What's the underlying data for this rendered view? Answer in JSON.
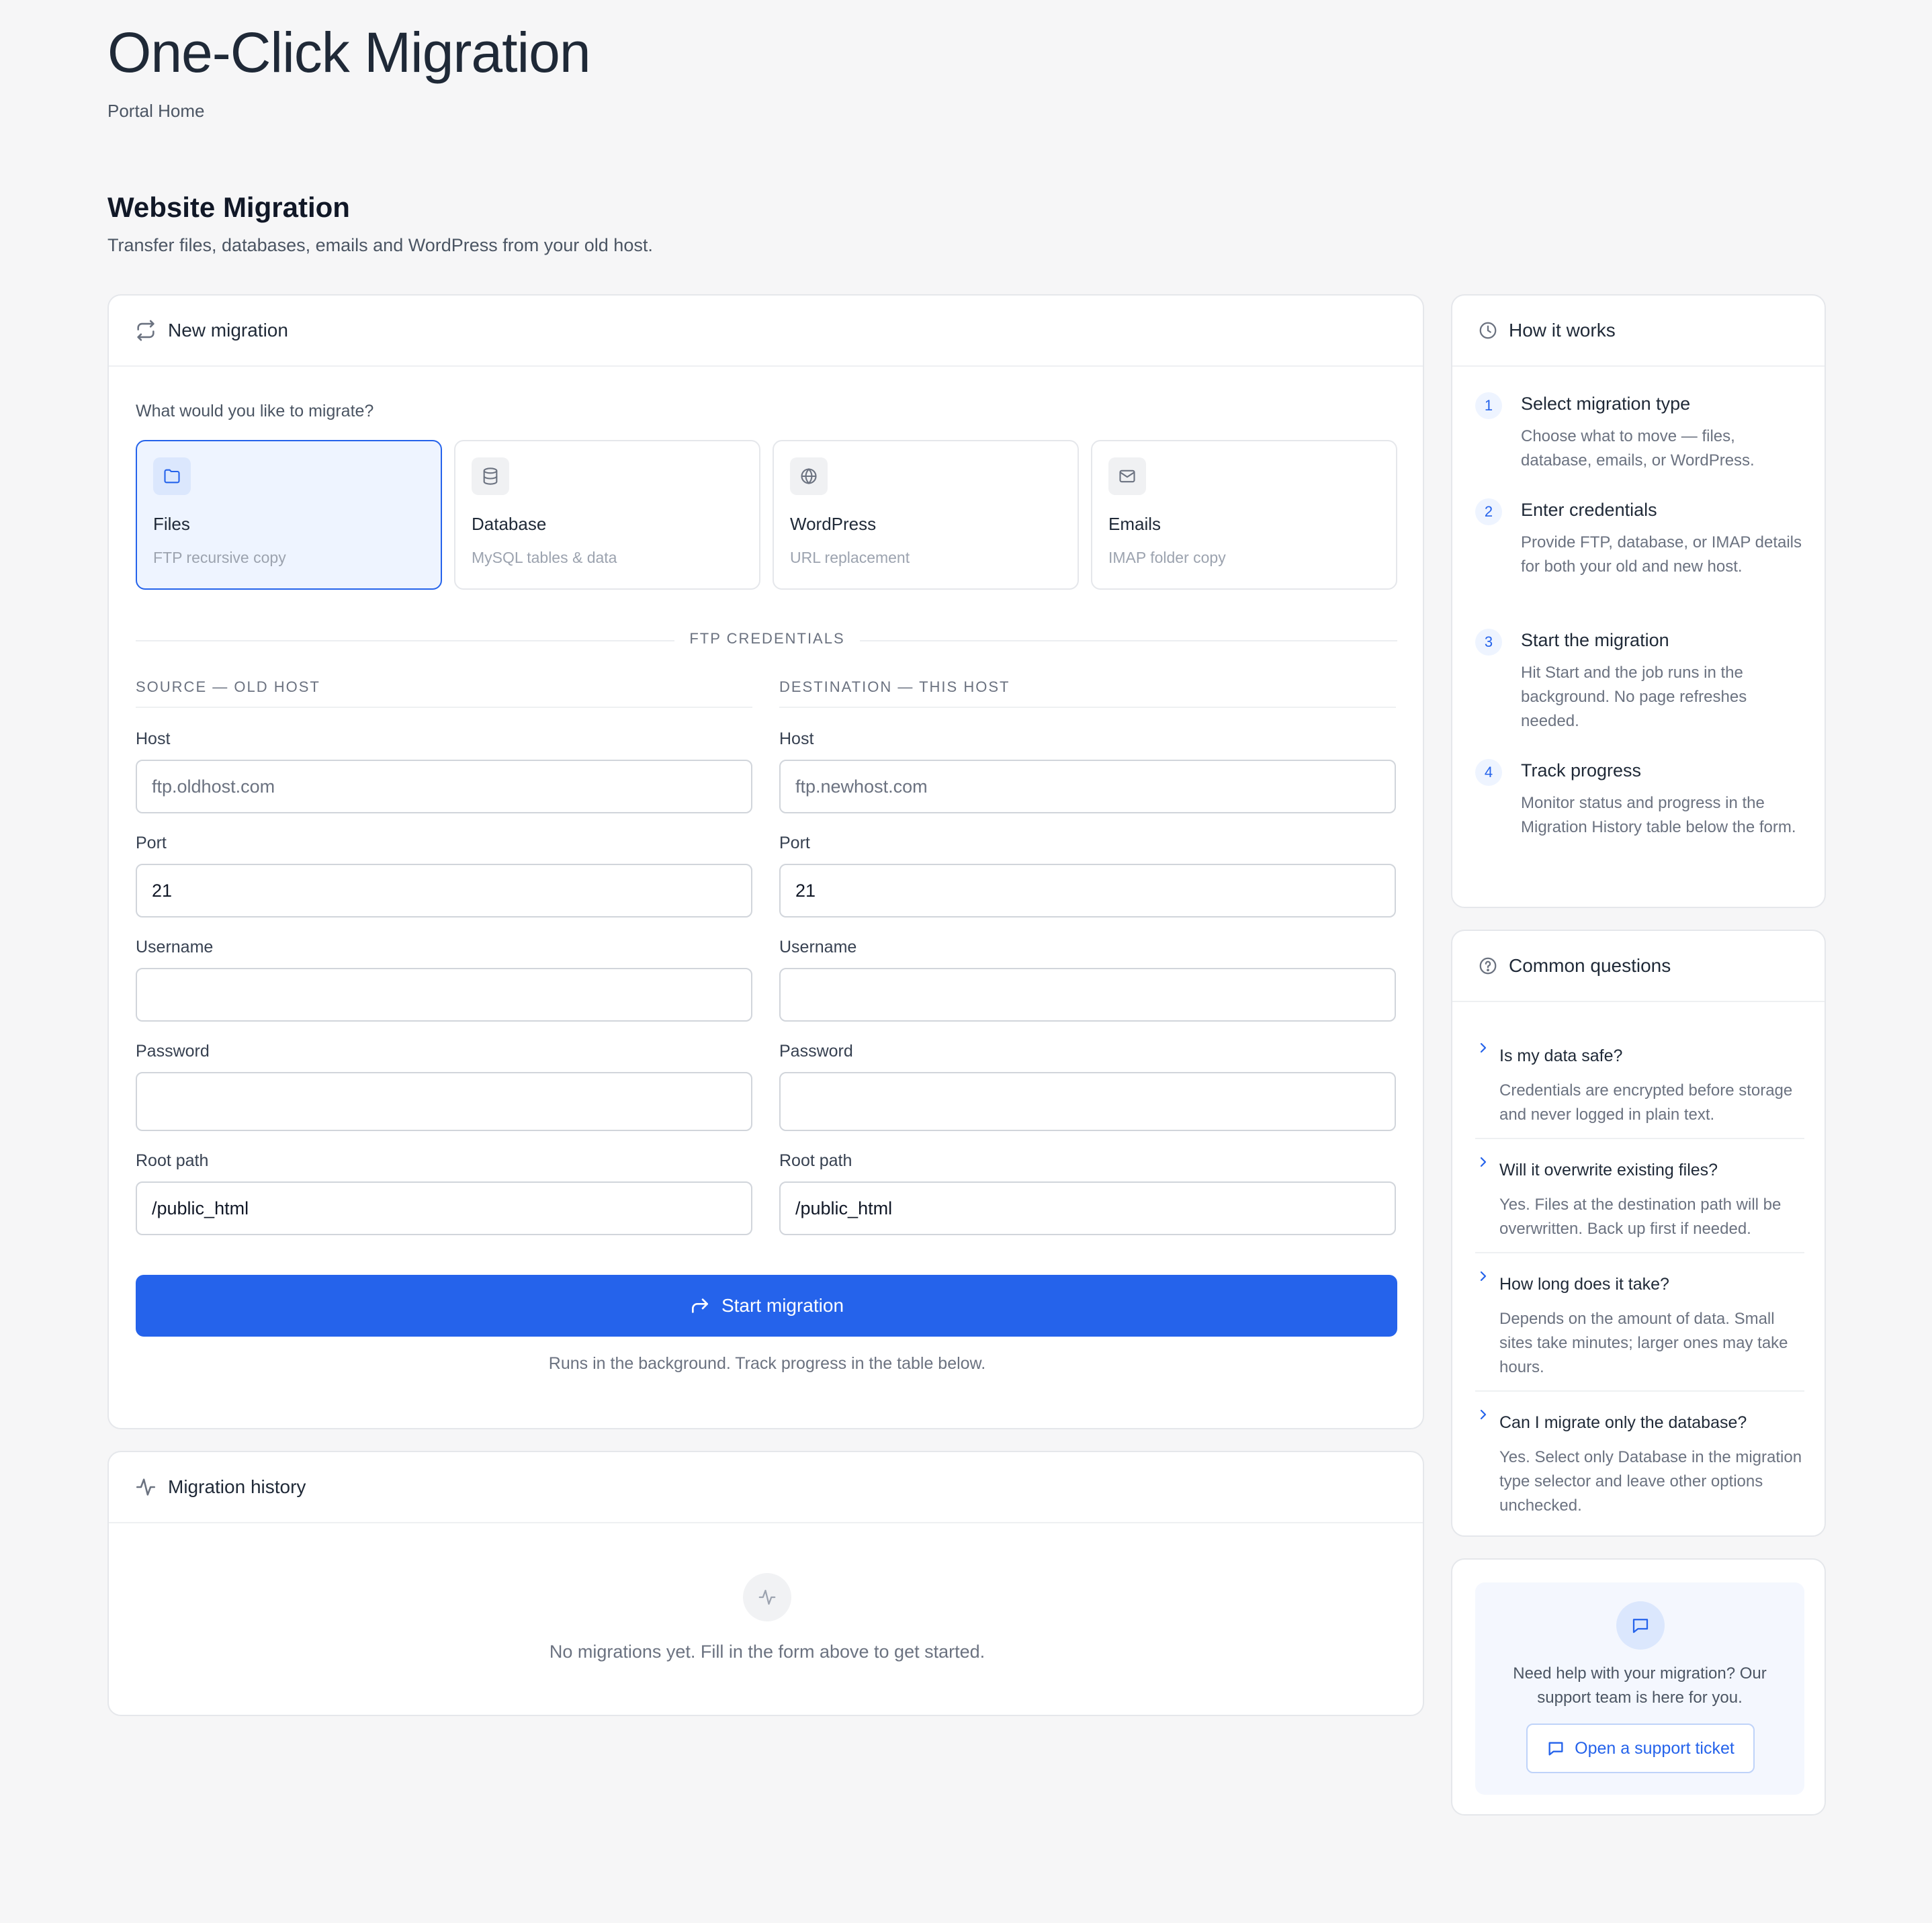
{
  "page": {
    "title": "One-Click Migration",
    "breadcrumb": "Portal Home"
  },
  "section": {
    "title": "Website Migration",
    "subtitle": "Transfer files, databases, emails and WordPress from your old host."
  },
  "new_migration": {
    "header": "New migration",
    "question": "What would you like to migrate?",
    "types": [
      {
        "name": "Files",
        "desc": "FTP recursive copy",
        "icon": "folder-icon",
        "selected": true
      },
      {
        "name": "Database",
        "desc": "MySQL tables & data",
        "icon": "database-icon",
        "selected": false
      },
      {
        "name": "WordPress",
        "desc": "URL replacement",
        "icon": "globe-icon",
        "selected": false
      },
      {
        "name": "Emails",
        "desc": "IMAP folder copy",
        "icon": "mail-icon",
        "selected": false
      }
    ],
    "credentials_label": "FTP CREDENTIALS",
    "source": {
      "heading": "SOURCE — OLD HOST",
      "host_label": "Host",
      "host_placeholder": "ftp.oldhost.com",
      "host_value": "",
      "port_label": "Port",
      "port_value": "21",
      "username_label": "Username",
      "username_value": "",
      "password_label": "Password",
      "password_value": "",
      "root_label": "Root path",
      "root_value": "/public_html"
    },
    "destination": {
      "heading": "DESTINATION — THIS HOST",
      "host_label": "Host",
      "host_placeholder": "ftp.newhost.com",
      "host_value": "",
      "port_label": "Port",
      "port_value": "21",
      "username_label": "Username",
      "username_value": "",
      "password_label": "Password",
      "password_value": "",
      "root_label": "Root path",
      "root_value": "/public_html"
    },
    "start_label": "Start migration",
    "note": "Runs in the background. Track progress in the table below."
  },
  "history": {
    "header": "Migration history",
    "empty": "No migrations yet. Fill in the form above to get started."
  },
  "how_it_works": {
    "header": "How it works",
    "steps": [
      {
        "num": "1",
        "title": "Select migration type",
        "desc": "Choose what to move — files, database, emails, or WordPress."
      },
      {
        "num": "2",
        "title": "Enter credentials",
        "desc": "Provide FTP, database, or IMAP details for both your old and new host."
      },
      {
        "num": "3",
        "title": "Start the migration",
        "desc": "Hit Start and the job runs in the background. No page refreshes needed."
      },
      {
        "num": "4",
        "title": "Track progress",
        "desc": "Monitor status and progress in the Migration History table below the form."
      }
    ]
  },
  "faq": {
    "header": "Common questions",
    "items": [
      {
        "q": "Is my data safe?",
        "a": "Credentials are encrypted before storage and never logged in plain text."
      },
      {
        "q": "Will it overwrite existing files?",
        "a": "Yes. Files at the destination path will be overwritten. Back up first if needed."
      },
      {
        "q": "How long does it take?",
        "a": "Depends on the amount of data. Small sites take minutes; larger ones may take hours."
      },
      {
        "q": "Can I migrate only the database?",
        "a": "Yes. Select only Database in the migration type selector and leave other options unchecked."
      }
    ]
  },
  "help": {
    "text": "Need help with your migration? Our support team is here for you.",
    "button": "Open a support ticket"
  },
  "colors": {
    "accent": "#2563eb",
    "background": "#f6f6f7",
    "card": "#ffffff",
    "selected_bg": "#eef4ff"
  }
}
